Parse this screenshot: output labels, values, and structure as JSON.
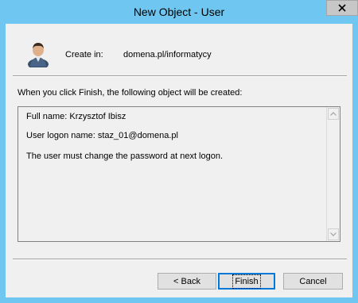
{
  "window": {
    "title": "New Object - User"
  },
  "header": {
    "create_in_label": "Create in:",
    "create_in_value": "domena.pl/informatycy",
    "user_icon": "user-icon"
  },
  "summary": {
    "intro": "When you click Finish, the following object will be created:",
    "lines": [
      "Full name: Krzysztof Ibisz",
      "User logon name: staz_01@domena.pl",
      "The user must change the password at next logon."
    ]
  },
  "buttons": {
    "back": "< Back",
    "finish": "Finish",
    "cancel": "Cancel"
  },
  "colors": {
    "title_bar": "#6fc7f1",
    "dialog_bg": "#f0f0f0",
    "default_button_border": "#0078d7"
  }
}
